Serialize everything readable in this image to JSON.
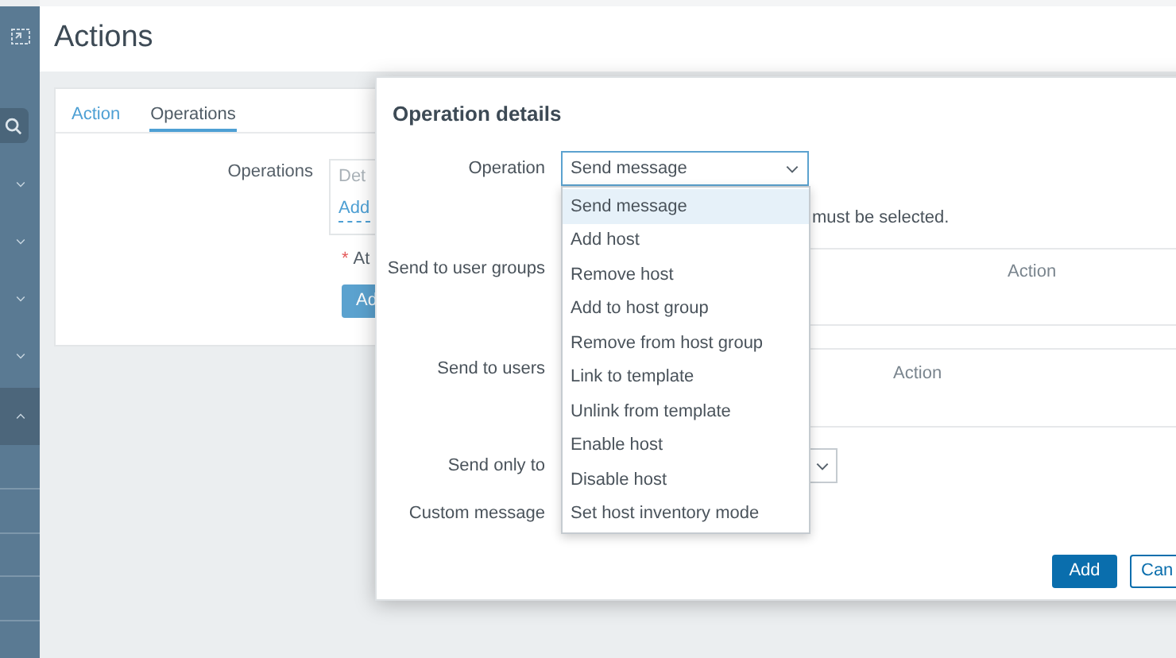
{
  "sidebar": {
    "sections": [
      {
        "expanded": false
      },
      {
        "expanded": false
      },
      {
        "expanded": false
      },
      {
        "expanded": false
      },
      {
        "expanded": true
      }
    ]
  },
  "page": {
    "title": "Actions"
  },
  "tabs": [
    {
      "label": "Action",
      "selected": false
    },
    {
      "label": "Operations",
      "selected": true
    }
  ],
  "form": {
    "operations_label": "Operations",
    "operations_header": "Det",
    "add_link": "Add",
    "required_mark": "*",
    "required_text": "At",
    "submit_button": "Ad"
  },
  "dialog": {
    "title": "Operation details",
    "operation": {
      "label": "Operation",
      "value": "Send message",
      "expanded": true
    },
    "options": [
      {
        "label": "Send message",
        "selected": true
      },
      {
        "label": "Add host",
        "selected": false
      },
      {
        "label": "Remove host",
        "selected": false
      },
      {
        "label": "Add to host group",
        "selected": false
      },
      {
        "label": "Remove from host group",
        "selected": false
      },
      {
        "label": "Link to template",
        "selected": false
      },
      {
        "label": "Unlink from template",
        "selected": false
      },
      {
        "label": "Enable host",
        "selected": false
      },
      {
        "label": "Disable host",
        "selected": false
      },
      {
        "label": "Set host inventory mode",
        "selected": false
      }
    ],
    "hint": "must be selected.",
    "user_groups": {
      "label": "Send to user groups",
      "column": "Action"
    },
    "users": {
      "label": "Send to users",
      "column": "Action"
    },
    "send_only_to": {
      "label": "Send only to"
    },
    "custom_message": {
      "label": "Custom message"
    },
    "buttons": [
      {
        "label": "Add",
        "kind": "primary"
      },
      {
        "label": "Can",
        "kind": "secondary"
      }
    ]
  }
}
